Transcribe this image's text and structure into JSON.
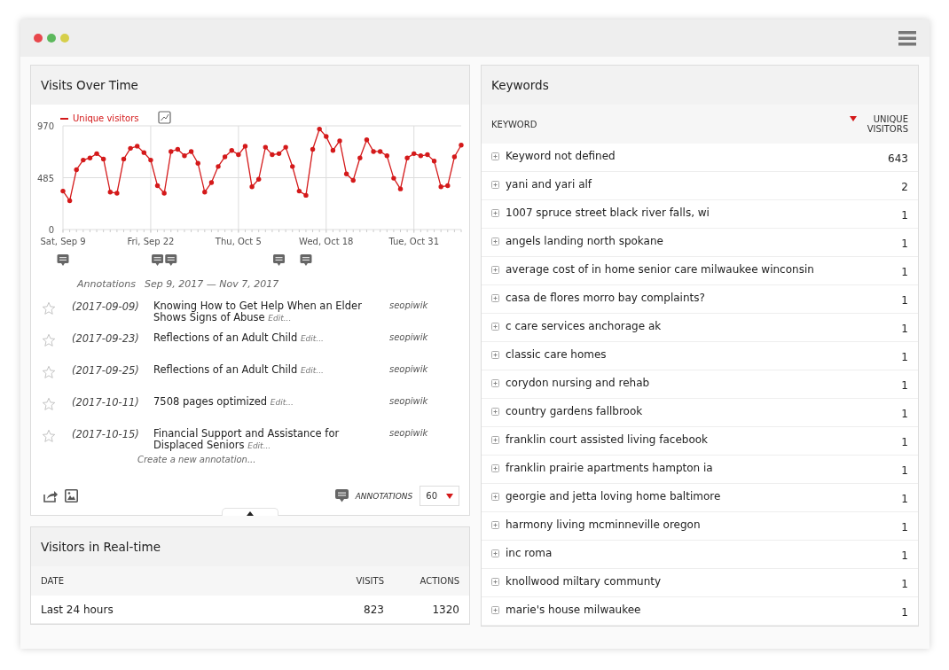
{
  "window": {
    "traffic_lights": [
      {
        "color": "#e8474c"
      },
      {
        "color": "#5cb85c"
      },
      {
        "color": "#d6cf4a"
      }
    ]
  },
  "visits_over_time": {
    "title": "Visits Over Time",
    "chart_data": {
      "type": "line",
      "categories": [
        "Sat, Sep 9",
        null,
        null,
        null,
        null,
        null,
        null,
        null,
        null,
        null,
        null,
        null,
        null,
        "Fri, Sep 22",
        null,
        null,
        null,
        null,
        null,
        null,
        null,
        null,
        null,
        null,
        null,
        null,
        "Thu, Oct 5",
        null,
        null,
        null,
        null,
        null,
        null,
        null,
        null,
        null,
        null,
        null,
        null,
        "Wed, Oct 18",
        null,
        null,
        null,
        null,
        null,
        null,
        null,
        null,
        null,
        null,
        null,
        null,
        "Tue, Oct 31",
        null,
        null,
        null,
        null,
        null,
        null,
        null
      ],
      "series": [
        {
          "name": "Unique visitors",
          "color": "#d4191a",
          "values": [
            360,
            270,
            560,
            650,
            670,
            710,
            660,
            350,
            340,
            660,
            760,
            780,
            720,
            650,
            410,
            340,
            730,
            750,
            690,
            730,
            620,
            350,
            440,
            590,
            680,
            740,
            700,
            780,
            400,
            470,
            770,
            700,
            710,
            770,
            590,
            360,
            320,
            750,
            940,
            870,
            740,
            830,
            520,
            460,
            670,
            840,
            730,
            730,
            690,
            480,
            380,
            670,
            710,
            690,
            700,
            640,
            400,
            410,
            680,
            790
          ]
        }
      ],
      "ylim": [
        0,
        970
      ],
      "yticks": [
        0,
        485,
        970
      ],
      "grid": true
    },
    "annotations_label": "Annotations",
    "annotations_range": "Sep 9, 2017 — Nov 7, 2017",
    "annotations": [
      {
        "starred": false,
        "date": "(2017-09-09)",
        "text": "Knowing How to Get Help When an Elder Shows Signs of Abuse",
        "edit": "Edit...",
        "author": "seopiwik"
      },
      {
        "starred": false,
        "date": "(2017-09-23)",
        "text": "Reflections of an Adult Child",
        "edit": "Edit...",
        "author": "seopiwik"
      },
      {
        "starred": false,
        "date": "(2017-09-25)",
        "text": "Reflections of an Adult Child",
        "edit": "Edit...",
        "author": "seopiwik"
      },
      {
        "starred": false,
        "date": "(2017-10-11)",
        "text": "7508 pages optimized",
        "edit": "Edit...",
        "author": "seopiwik"
      },
      {
        "starred": false,
        "date": "(2017-10-15)",
        "text": "Financial Support and Assistance for Displaced Seniors",
        "edit": "Edit...",
        "author": "seopiwik"
      }
    ],
    "create_link": "Create a new annotation...",
    "footer_label": "ANNOTATIONS",
    "limit": "60"
  },
  "realtime": {
    "title": "Visitors in Real-time",
    "columns": [
      "DATE",
      "VISITS",
      "ACTIONS"
    ],
    "rows": [
      {
        "date": "Last 24 hours",
        "visits": "823",
        "actions": "1320"
      }
    ]
  },
  "keywords": {
    "title": "Keywords",
    "columns": [
      "KEYWORD",
      "UNIQUE VISITORS"
    ],
    "rows": [
      {
        "keyword": "Keyword not defined",
        "visitors": "643"
      },
      {
        "keyword": "yani and yari alf",
        "visitors": "2"
      },
      {
        "keyword": "1007 spruce street black river falls, wi",
        "visitors": "1"
      },
      {
        "keyword": "angels landing north spokane",
        "visitors": "1"
      },
      {
        "keyword": "average cost of in home senior care milwaukee winconsin",
        "visitors": "1"
      },
      {
        "keyword": "casa de flores morro bay complaints?",
        "visitors": "1"
      },
      {
        "keyword": "c care services anchorage ak",
        "visitors": "1"
      },
      {
        "keyword": "classic care homes",
        "visitors": "1"
      },
      {
        "keyword": "corydon nursing and rehab",
        "visitors": "1"
      },
      {
        "keyword": "country gardens fallbrook",
        "visitors": "1"
      },
      {
        "keyword": "franklin court assisted living facebook",
        "visitors": "1"
      },
      {
        "keyword": "franklin prairie apartments hampton ia",
        "visitors": "1"
      },
      {
        "keyword": "georgie and jetta loving home baltimore",
        "visitors": "1"
      },
      {
        "keyword": "harmony living mcminneville oregon",
        "visitors": "1"
      },
      {
        "keyword": "inc roma",
        "visitors": "1"
      },
      {
        "keyword": "knollwood miltary communty",
        "visitors": "1"
      },
      {
        "keyword": "marie's house milwaukee",
        "visitors": "1"
      }
    ]
  }
}
